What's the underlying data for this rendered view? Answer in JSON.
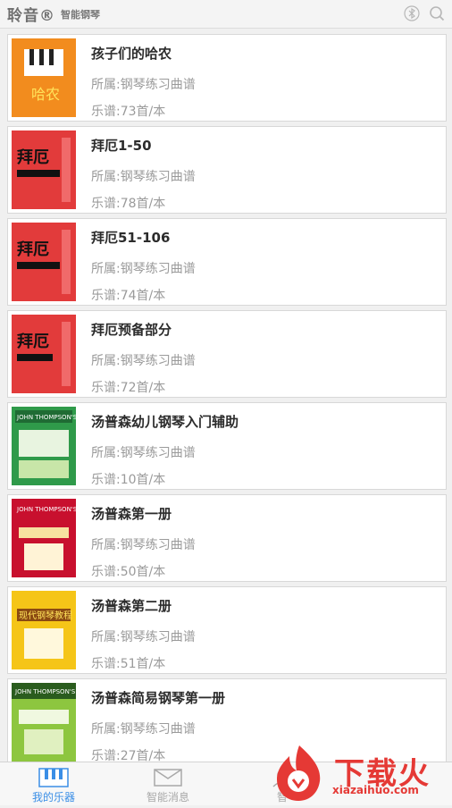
{
  "header": {
    "brand": "聆音®",
    "subtitle": "智能钢琴",
    "icons": [
      "bluetooth-icon",
      "search-icon"
    ]
  },
  "books": [
    {
      "title": "孩子们的哈农",
      "category": "所属:钢琴练习曲谱",
      "count": "乐谱:73首/本",
      "cover_color": "#f28c1e",
      "cover_text": "哈农"
    },
    {
      "title": "拜厄1-50",
      "category": "所属:钢琴练习曲谱",
      "count": "乐谱:78首/本",
      "cover_color": "#e23b3b",
      "cover_text": "拜厄"
    },
    {
      "title": "拜厄51-106",
      "category": "所属:钢琴练习曲谱",
      "count": "乐谱:74首/本",
      "cover_color": "#e23b3b",
      "cover_text": "拜厄"
    },
    {
      "title": "拜厄预备部分",
      "category": "所属:钢琴练习曲谱",
      "count": "乐谱:72首/本",
      "cover_color": "#e23b3b",
      "cover_text": "拜厄"
    },
    {
      "title": "汤普森幼儿钢琴入门辅助",
      "category": "所属:钢琴练习曲谱",
      "count": "乐谱:10首/本",
      "cover_color": "#2f9a4a",
      "cover_text": "JOHN THOMPSON'S"
    },
    {
      "title": "汤普森第一册",
      "category": "所属:钢琴练习曲谱",
      "count": "乐谱:50首/本",
      "cover_color": "#c8102e",
      "cover_text": "JOHN THOMPSON'S"
    },
    {
      "title": "汤普森第二册",
      "category": "所属:钢琴练习曲谱",
      "count": "乐谱:51首/本",
      "cover_color": "#f5c518",
      "cover_text": "现代钢琴教程"
    },
    {
      "title": "汤普森简易钢琴第一册",
      "category": "所属:钢琴练习曲谱",
      "count": "乐谱:27首/本",
      "cover_color": "#8dc63f",
      "cover_text": "JOHN THOMPSON'S"
    }
  ],
  "tabs": [
    {
      "label": "我的乐器",
      "icon": "piano-icon",
      "active": true
    },
    {
      "label": "智能消息",
      "icon": "mail-icon",
      "active": false
    },
    {
      "label": "智",
      "icon": "user-icon",
      "active": false
    }
  ],
  "watermark": {
    "text": "下载火",
    "url": "xiazaihuo.com"
  }
}
